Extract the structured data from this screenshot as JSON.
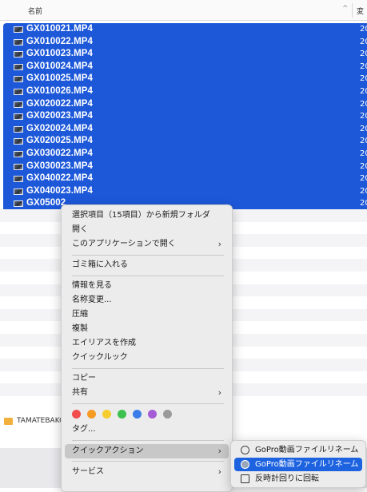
{
  "header": {
    "name_col": "名前",
    "sort_indicator": "^",
    "modified_col": "変"
  },
  "files": [
    {
      "name": "GX010021.MP4",
      "date": "20"
    },
    {
      "name": "GX010022.MP4",
      "date": "20"
    },
    {
      "name": "GX010023.MP4",
      "date": "20"
    },
    {
      "name": "GX010024.MP4",
      "date": "20"
    },
    {
      "name": "GX010025.MP4",
      "date": "20"
    },
    {
      "name": "GX010026.MP4",
      "date": "20"
    },
    {
      "name": "GX020022.MP4",
      "date": "20"
    },
    {
      "name": "GX020023.MP4",
      "date": "20"
    },
    {
      "name": "GX020024.MP4",
      "date": "20"
    },
    {
      "name": "GX020025.MP4",
      "date": "20"
    },
    {
      "name": "GX030022.MP4",
      "date": "20"
    },
    {
      "name": "GX030023.MP4",
      "date": "20"
    },
    {
      "name": "GX040022.MP4",
      "date": "20"
    },
    {
      "name": "GX040023.MP4",
      "date": "20"
    },
    {
      "name": "GX05002",
      "date": "20"
    }
  ],
  "folder": {
    "label": "TAMATEBAKO"
  },
  "context_menu": {
    "new_folder": "選択項目（15項目）から新規フォルダ",
    "open": "開く",
    "open_with": "このアプリケーションで開く",
    "trash": "ゴミ箱に入れる",
    "get_info": "情報を見る",
    "rename": "名称変更...",
    "compress": "圧縮",
    "duplicate": "複製",
    "make_alias": "エイリアスを作成",
    "quick_look": "クイックルック",
    "copy": "コピー",
    "share": "共有",
    "tags": "タグ...",
    "quick_actions": "クイックアクション",
    "services": "サービス",
    "tag_colors": [
      "#f24d4d",
      "#f59a23",
      "#f6cd2e",
      "#3cc04e",
      "#3a7de8",
      "#a55bd6",
      "#9a9a9a"
    ]
  },
  "submenu": {
    "item1": "GoPro動画ファイルリネーム",
    "item2": "GoPro動画ファイルリネーム",
    "item3": "反時計回りに回転"
  }
}
